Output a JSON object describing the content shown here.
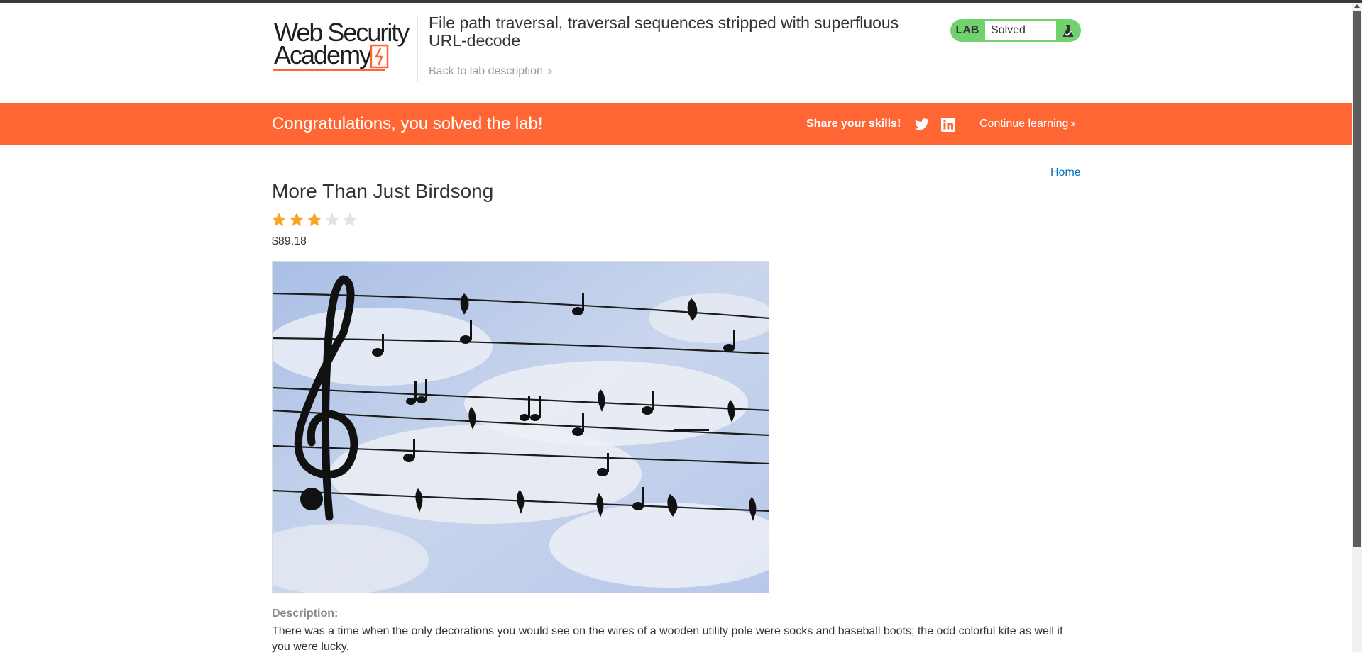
{
  "header": {
    "logo_line1": "Web Security",
    "logo_line2": "Academy",
    "lab_title": "File path traversal, traversal sequences stripped with superfluous URL-decode",
    "back_link": "Back to lab description",
    "status_label": "LAB",
    "status_value": "Solved"
  },
  "banner": {
    "message": "Congratulations, you solved the lab!",
    "share_label": "Share your skills!",
    "continue_label": "Continue learning"
  },
  "nav": {
    "home": "Home"
  },
  "product": {
    "title": "More Than Just Birdsong",
    "rating": 3,
    "max_rating": 5,
    "price": "$89.18",
    "description_label": "Description:",
    "description": "There was a time when the only decorations you would see on the wires of a wooden utility pole were socks and baseball boots; the odd colorful kite as well if you were lucky."
  },
  "colors": {
    "accent": "#ff6633",
    "solved_green": "#70d16d",
    "star_filled": "#f5a623",
    "star_empty": "#dfe3e6",
    "link": "#0071bc"
  },
  "icons": {
    "twitter": "twitter-icon",
    "linkedin": "linkedin-icon",
    "flask": "flask-icon"
  }
}
